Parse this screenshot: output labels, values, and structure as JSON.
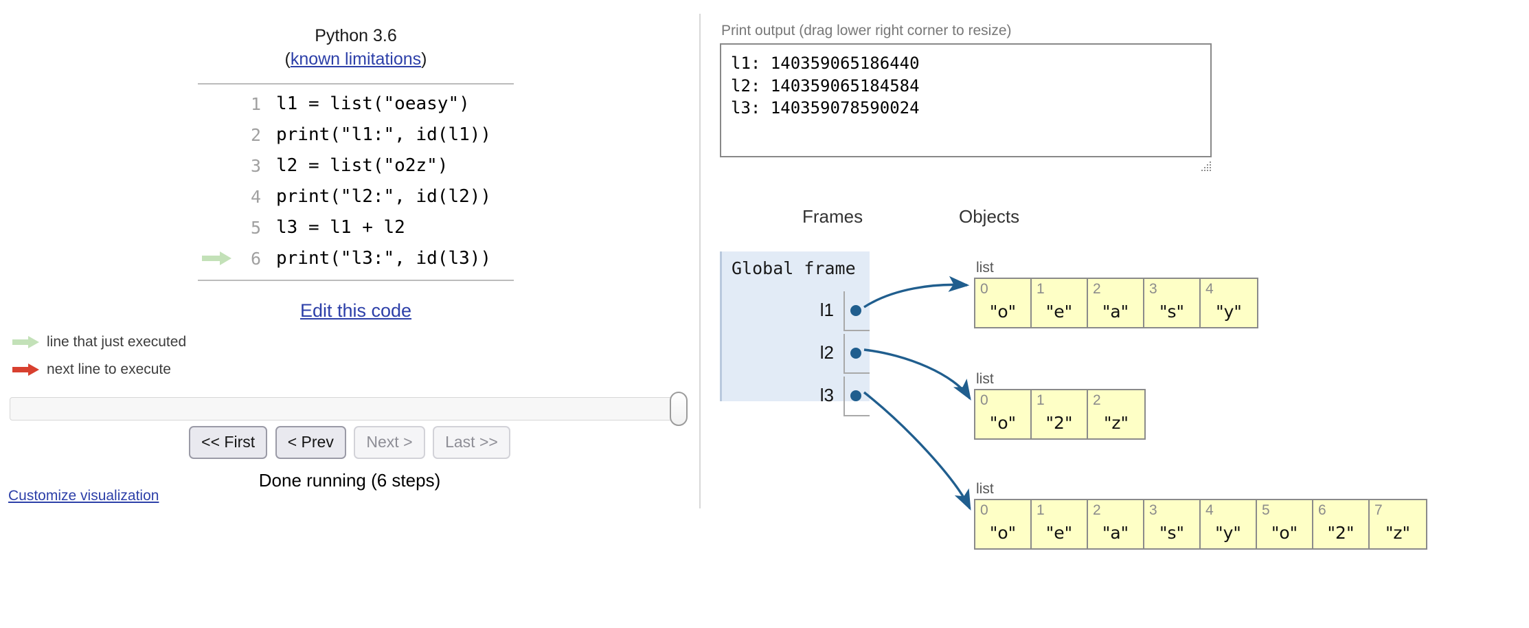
{
  "code_panel": {
    "python_version": "Python 3.6",
    "limitations_prefix": "(",
    "limitations_link": "known limitations",
    "limitations_suffix": ")",
    "lines": [
      {
        "number": "1",
        "text": "l1 = list(\"oeasy\")",
        "marker": "none"
      },
      {
        "number": "2",
        "text": "print(\"l1:\", id(l1))",
        "marker": "none"
      },
      {
        "number": "3",
        "text": "l2 = list(\"o2z\")",
        "marker": "none"
      },
      {
        "number": "4",
        "text": "print(\"l2:\", id(l2))",
        "marker": "none"
      },
      {
        "number": "5",
        "text": "l3 = l1 + l2",
        "marker": "none"
      },
      {
        "number": "6",
        "text": "print(\"l3:\", id(l3))",
        "marker": "green-arrow"
      }
    ],
    "edit_code_label": "Edit this code"
  },
  "legend": {
    "just_executed": "line that just executed",
    "next_to_execute": "next line to execute",
    "green_arrow_color": "#c3e1b8",
    "red_arrow_color": "#d8402f"
  },
  "controls": {
    "first_label": "<< First",
    "prev_label": "< Prev",
    "next_label": "Next >",
    "last_label": "Last >>",
    "status": "Done running (6 steps)",
    "customize_label": "Customize visualization",
    "slider_position_percent": 100
  },
  "print_output": {
    "label": "Print output (drag lower right corner to resize)",
    "lines": [
      "l1: 140359065186440",
      "l2: 140359065184584",
      "l3: 140359078590024"
    ]
  },
  "visualization": {
    "frames_heading": "Frames",
    "objects_heading": "Objects",
    "frame": {
      "title": "Global frame",
      "background": "#e2ebf6",
      "variables": [
        {
          "name": "l1"
        },
        {
          "name": "l2"
        },
        {
          "name": "l3"
        }
      ]
    },
    "objects": [
      {
        "type_label": "list",
        "indices": [
          "0",
          "1",
          "2",
          "3",
          "4"
        ],
        "values": [
          "\"o\"",
          "\"e\"",
          "\"a\"",
          "\"s\"",
          "\"y\""
        ]
      },
      {
        "type_label": "list",
        "indices": [
          "0",
          "1",
          "2"
        ],
        "values": [
          "\"o\"",
          "\"2\"",
          "\"z\""
        ]
      },
      {
        "type_label": "list",
        "indices": [
          "0",
          "1",
          "2",
          "3",
          "4",
          "5",
          "6",
          "7"
        ],
        "values": [
          "\"o\"",
          "\"e\"",
          "\"a\"",
          "\"s\"",
          "\"y\"",
          "\"o\"",
          "\"2\"",
          "\"z\""
        ]
      }
    ],
    "pointer_color": "#205e8e",
    "object_cell_color": "#feffc6"
  }
}
